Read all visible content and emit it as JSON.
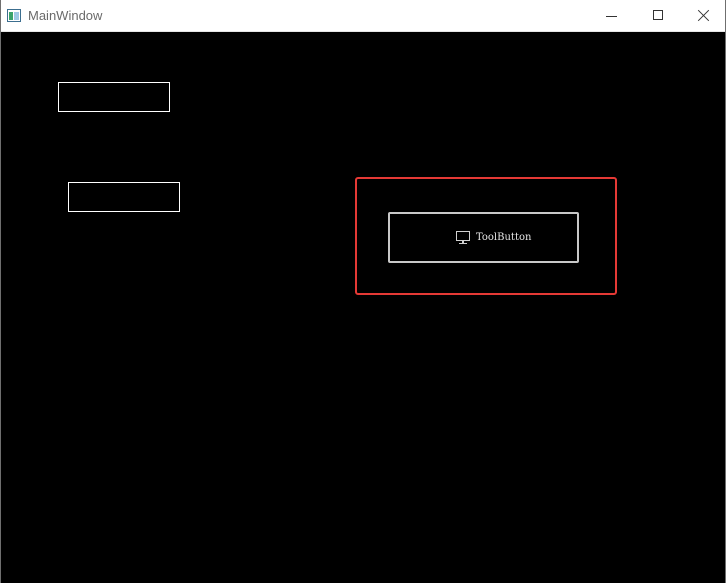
{
  "window": {
    "title": "MainWindow",
    "app_icon": "qt-window-icon",
    "controls": {
      "minimize_icon": "minimize-icon",
      "maximize_icon": "maximize-icon",
      "close_icon": "close-icon"
    }
  },
  "main": {
    "line_edit_1": {
      "value": ""
    },
    "line_edit_2": {
      "value": ""
    },
    "tool_button": {
      "label": "ToolButton",
      "icon": "monitor-icon"
    },
    "highlight_color": "#e53935",
    "background": "#000000"
  }
}
